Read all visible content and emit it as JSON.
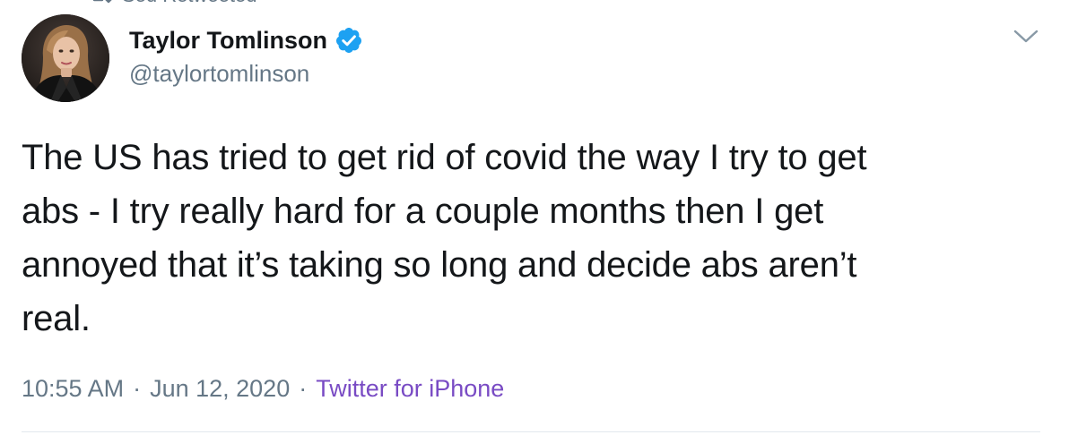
{
  "retweet_context": {
    "text": "Sed Retweeted",
    "icon": "retweet-icon"
  },
  "author": {
    "name": "Taylor Tomlinson",
    "handle": "@taylortomlinson",
    "verified": true,
    "avatar": "avatar-photo"
  },
  "tweet": {
    "text": "The US has tried to get rid of covid the way I try to get\nabs - I try really hard for a couple months then I get\nannoyed that it’s taking so long and decide abs aren’t\nreal.",
    "time": "10:55 AM",
    "separator": "·",
    "date": "Jun 12, 2020",
    "source": "Twitter for iPhone"
  },
  "menu": {
    "icon": "chevron-down-icon"
  },
  "colors": {
    "primary_text": "#14171a",
    "secondary_text": "#657786",
    "source_link": "#794bc4",
    "verified_badge": "#1da1f2",
    "divider": "#e1e8ed"
  }
}
